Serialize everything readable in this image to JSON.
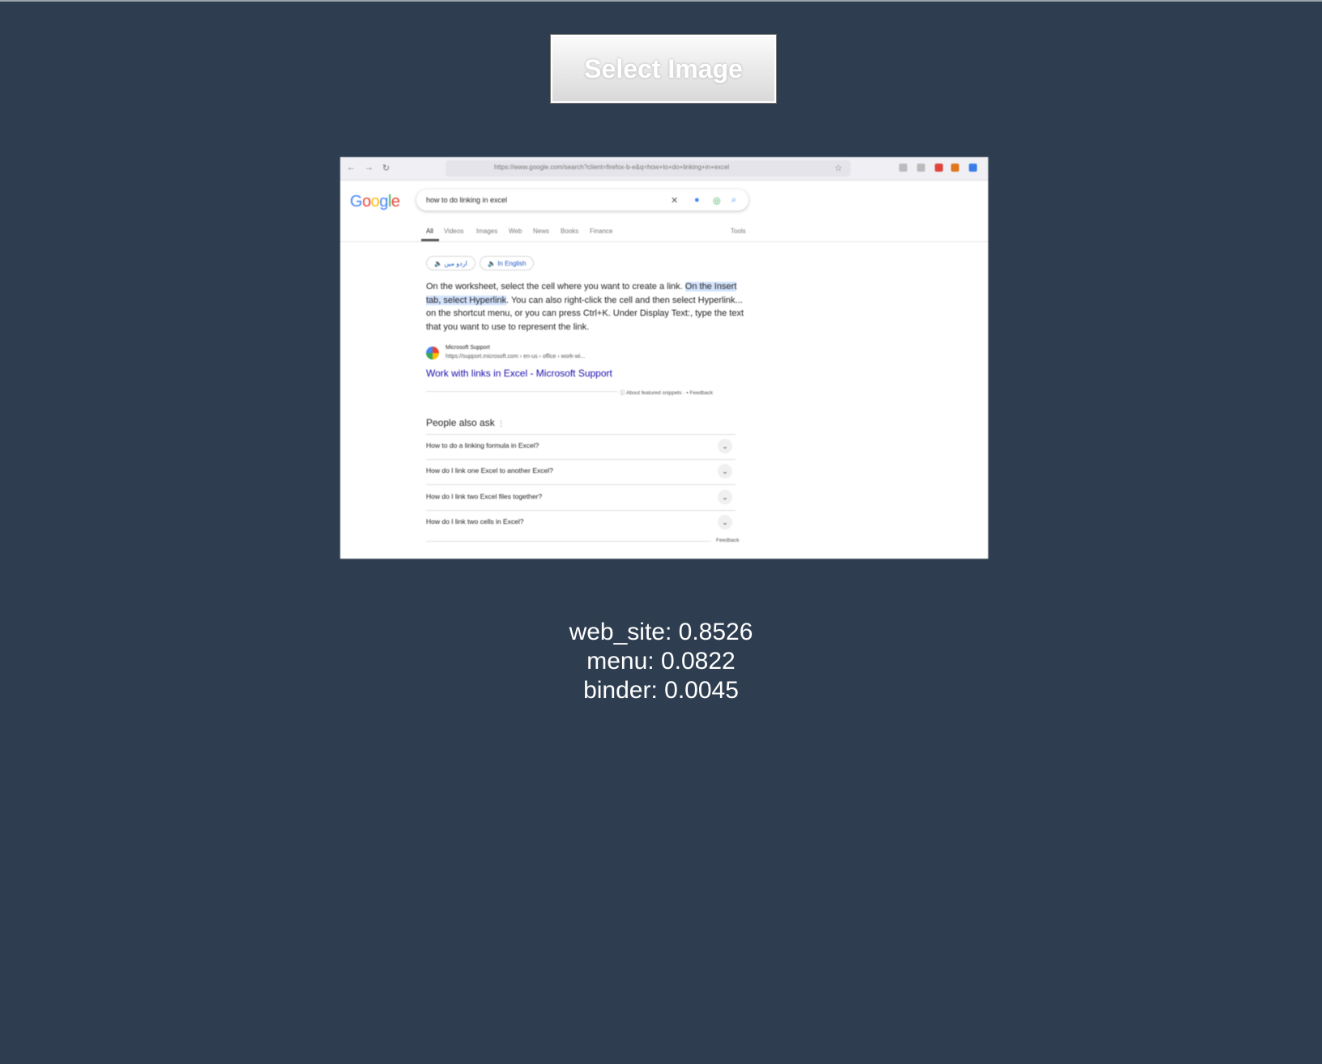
{
  "controls": {
    "select_image_label": "Select Image"
  },
  "preview": {
    "browser": {
      "url": "https://www.google.com/search?client=firefox-b-e&q=how+to+do+linking+in+excel",
      "nav_icons": [
        "arrow-left-icon",
        "arrow-right-icon",
        "reload-icon"
      ]
    },
    "google_logo": "Google",
    "search_query": "how to do linking in excel",
    "tabs": [
      "All",
      "Videos",
      "Images",
      "Web",
      "News",
      "Books",
      "Finance"
    ],
    "tools_label": "Tools",
    "language_chips": [
      "اردو میں",
      "In English"
    ],
    "snippet": {
      "part1": "On the worksheet, select the cell where you want to create a link. ",
      "highlight": "On the Insert tab, select Hyperlink",
      "part2": ". You can also right-click the cell and then select Hyperlink... on the shortcut menu, or you can press Ctrl+K. Under Display Text:, type the text that you want to use to represent the link."
    },
    "source": {
      "name": "Microsoft Support",
      "url": "https://support.microsoft.com › en-us › office › work-wi...",
      "link_title": "Work with links in Excel - Microsoft Support"
    },
    "about_snippets": "About featured snippets",
    "feedback": "Feedback",
    "people_also_ask": {
      "heading": "People also ask",
      "questions": [
        "How to do a linking formula in Excel?",
        "How do I link one Excel to another Excel?",
        "How do I link two Excel files together?",
        "How do I link two cells in Excel?"
      ],
      "feedback": "Feedback"
    }
  },
  "predictions": [
    {
      "label": "web_site",
      "score": "0.8526"
    },
    {
      "label": "menu",
      "score": "0.0822"
    },
    {
      "label": "binder",
      "score": "0.0045"
    }
  ],
  "prediction_lines": [
    "web_site: 0.8526",
    "menu: 0.0822",
    "binder: 0.0045"
  ],
  "colors": {
    "page_background": "#2e3e50",
    "result_text": "#ffffff",
    "link_blue": "#1a0dab"
  }
}
